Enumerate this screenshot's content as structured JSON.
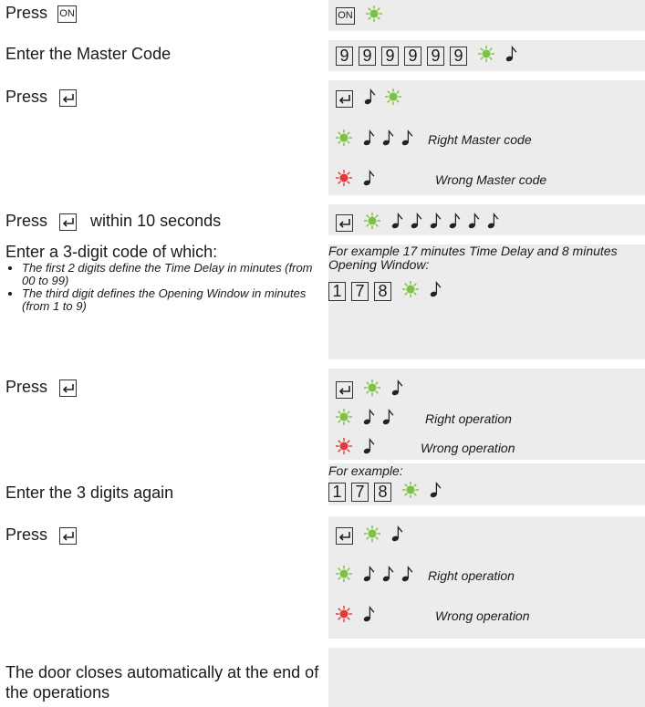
{
  "steps": [
    {
      "left": "Press",
      "key": "ON"
    },
    {
      "left": "Enter the Master Code",
      "digits": [
        "9",
        "9",
        "9",
        "9",
        "9",
        "9"
      ]
    },
    {
      "left": "Press"
    },
    {
      "right_caption": "Right Master code"
    },
    {
      "right_caption": "Wrong Master code"
    },
    {
      "left": "Press",
      "left_suffix": "within 10 seconds"
    },
    {
      "left": "Enter a 3-digit code of which:",
      "bullets": [
        "The first 2 digits define the Time Delay in minutes (from 00 to 99)",
        "The third digit defines the Opening Window in minutes (from 1 to 9)"
      ],
      "right_caption": "For example 17 minutes Time Delay and 8 minutes Opening Window:",
      "digits": [
        "1",
        "7",
        "8"
      ]
    },
    {
      "left": "Press"
    },
    {
      "right_caption": "Right operation"
    },
    {
      "right_caption": "Wrong operation"
    },
    {
      "left": "Enter the 3 digits again",
      "right_caption": "For example:",
      "digits": [
        "1",
        "7",
        "8"
      ]
    },
    {
      "left": "Press"
    },
    {
      "right_caption": "Right operation"
    },
    {
      "right_caption": "Wrong operation"
    },
    {
      "left": "The door closes automatically at the end of the operations"
    }
  ],
  "led_labels": {
    "green": "V",
    "red": "R"
  },
  "colors": {
    "green_led": "#7cc242",
    "red_led": "#e23a3a",
    "panel": "#ececec"
  },
  "icons": [
    "return-key-icon",
    "green-led-icon",
    "red-led-icon",
    "beep-note-icon"
  ]
}
